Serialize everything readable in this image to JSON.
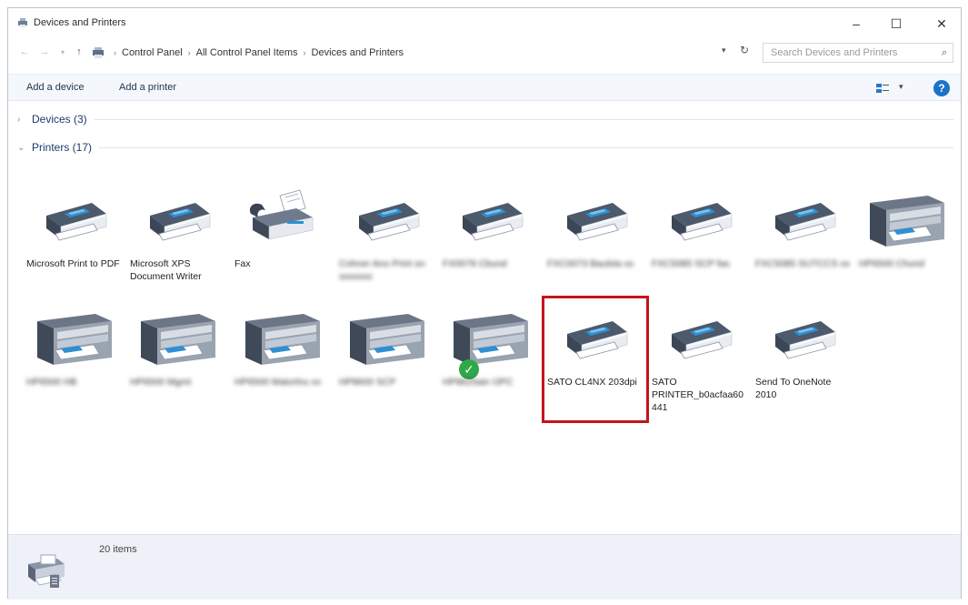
{
  "window": {
    "title": "Devices and Printers",
    "controls": {
      "minimize": "–",
      "maximize": "☐",
      "close": "✕"
    }
  },
  "address": {
    "breadcrumb": [
      "Control Panel",
      "All Control Panel Items",
      "Devices and Printers"
    ],
    "search_placeholder": "Search Devices and Printers"
  },
  "toolbar": {
    "add_device": "Add a device",
    "add_printer": "Add a printer",
    "help": "?"
  },
  "groups": {
    "devices": {
      "label": "Devices (3)",
      "collapsed": true
    },
    "printers": {
      "label": "Printers (17)",
      "collapsed": false
    }
  },
  "printers": [
    {
      "name": "Microsoft Print to PDF",
      "icon": "printer-icon",
      "blurred": false
    },
    {
      "name": "Microsoft XPS Document Writer",
      "icon": "printer-icon",
      "blurred": false
    },
    {
      "name": "Fax",
      "icon": "fax-icon",
      "blurred": false
    },
    {
      "name": "Cohner Ano Print on xxxxxxx",
      "icon": "printer-icon",
      "blurred": true
    },
    {
      "name": "FX0079 Cbund",
      "icon": "printer-icon",
      "blurred": true
    },
    {
      "name": "FXC0073 Baulsla xx",
      "icon": "printer-icon",
      "blurred": true
    },
    {
      "name": "FXC5085 SCP fas",
      "icon": "printer-icon",
      "blurred": true
    },
    {
      "name": "FXC5085 SUTCCS xx",
      "icon": "printer-icon",
      "blurred": true
    },
    {
      "name": "HP6500 Chund",
      "icon": "mfp-icon",
      "blurred": true
    },
    {
      "name": "HP6500 HB",
      "icon": "mfp-icon",
      "blurred": true
    },
    {
      "name": "HP6500 Mgmt",
      "icon": "mfp-icon",
      "blurred": true
    },
    {
      "name": "HP6500 Matorlnu xx",
      "icon": "mfp-icon",
      "blurred": true
    },
    {
      "name": "HP8600 SCP",
      "icon": "mfp-icon",
      "blurred": true
    },
    {
      "name": "HP8625ain OPC",
      "icon": "mfp-icon",
      "blurred": true,
      "default": true
    },
    {
      "name": "SATO CL4NX 203dpi",
      "icon": "printer-icon",
      "blurred": false,
      "selected": true
    },
    {
      "name": "SATO PRINTER_b0acfaa60441",
      "icon": "printer-icon",
      "blurred": false
    },
    {
      "name": "Send To OneNote 2010",
      "icon": "printer-icon",
      "blurred": false
    }
  ],
  "details": {
    "count": "20 items"
  },
  "colors": {
    "selection_border": "#c4141c",
    "header_text": "#1e3a6b",
    "default_check": "#2fa84a",
    "help": "#1a73c9"
  }
}
